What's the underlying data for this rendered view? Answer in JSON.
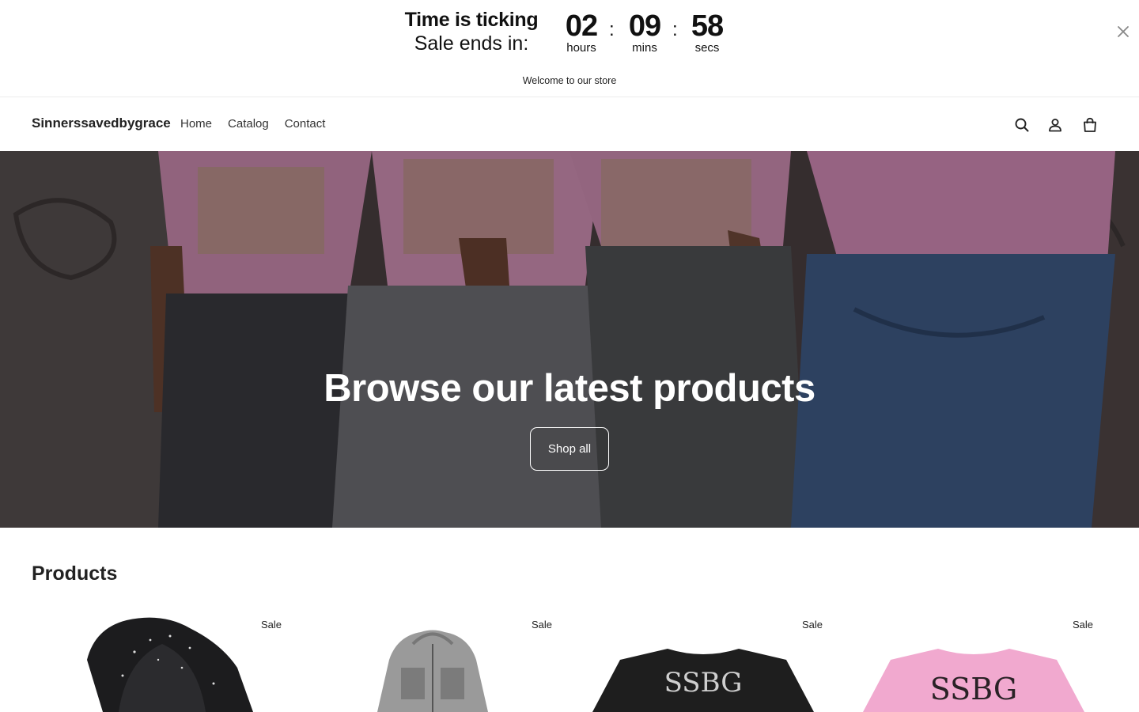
{
  "countdown": {
    "headline": "Time is ticking",
    "subline": "Sale ends in:",
    "hours": "02",
    "hours_label": "hours",
    "minutes": "09",
    "minutes_label": "mins",
    "seconds": "58",
    "seconds_label": "secs",
    "separator": ":"
  },
  "announcement": {
    "text": "Welcome to our store"
  },
  "header": {
    "logo": "Sinnerssavedbygrace",
    "nav": [
      "Home",
      "Catalog",
      "Contact"
    ],
    "icons": [
      "search-icon",
      "account-icon",
      "cart-icon"
    ]
  },
  "hero": {
    "title": "Browse our latest products",
    "button_label": "Shop all"
  },
  "products": {
    "heading": "Products",
    "items": [
      {
        "badge": "Sale"
      },
      {
        "badge": "Sale"
      },
      {
        "badge": "Sale"
      },
      {
        "badge": "Sale"
      }
    ]
  },
  "colors": {
    "text": "#222222",
    "hero_shirt_pink": "#d889b5",
    "hero_jeans_blue": "#3f5a86"
  }
}
